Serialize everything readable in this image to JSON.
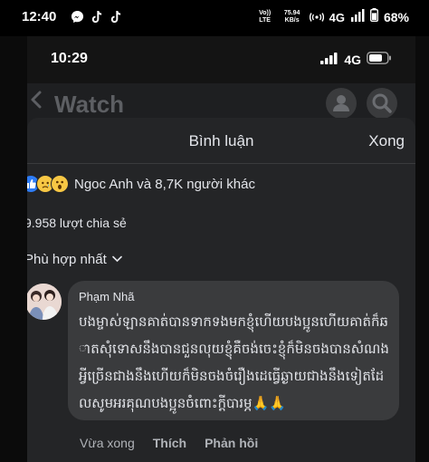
{
  "outer_status": {
    "time": "12:40",
    "volte": "Vo)) LTE",
    "speed": "75.94 KB/s",
    "network": "4G",
    "battery": "68%"
  },
  "inner_status": {
    "time": "10:29",
    "network": "4G"
  },
  "watch": {
    "title": "Watch"
  },
  "comments_sheet": {
    "title": "Bình luận",
    "done_label": "Xong",
    "reactions_text": "Ngoc Anh và 8,7K người khác",
    "shares_text": "9.958 lượt chia sẻ",
    "sort_label": "Phù hợp nhất",
    "comment": {
      "author": "Phạm Nhã",
      "text": "បងម្ចាស់ឡានគាត់បានទាកទងមកខ្ញុំហើយបងប្អូនហើយគាត់ក៏ឆាតសុំទោសនឹងបានជួនលុយខ្ញុំគឺចង់ចេះខ្ញុំក៏មិនចងបានសំណងអ្វីច្រើនជាងនឹងហើយក៏មិនចងចំរឿងដេធ្វើឆ្ងាយជាងនឹងទៀតដែលសូមអរគុណបងប្អូនចំពោះក្ដីបារម្ភ🙏🙏",
      "time": "Vừa xong",
      "like_label": "Thích",
      "reply_label": "Phản hồi"
    }
  }
}
